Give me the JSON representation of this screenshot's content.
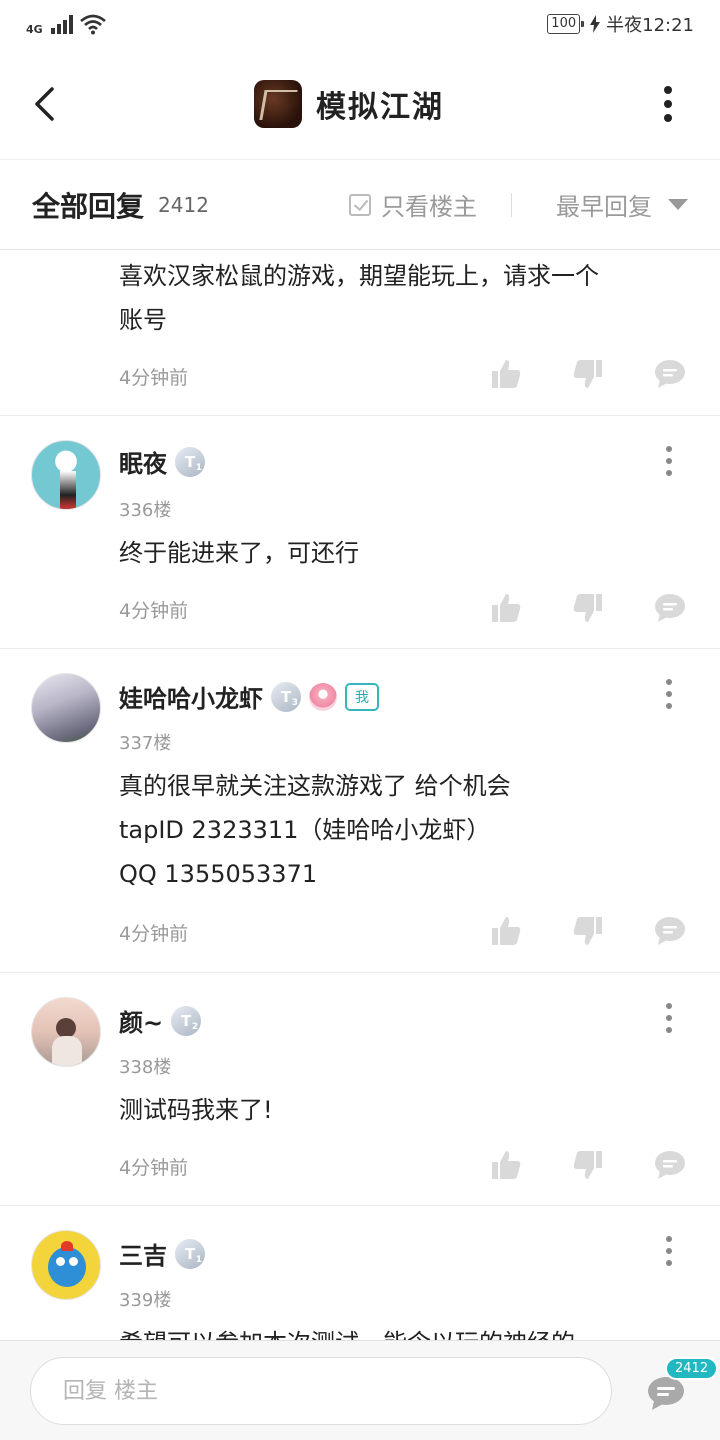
{
  "status_bar": {
    "network": "4G",
    "battery": "100",
    "time": "半夜12:21"
  },
  "header": {
    "title": "模拟江湖"
  },
  "filter_bar": {
    "title": "全部回复",
    "count": "2412",
    "only_op_label": "只看楼主",
    "sort_label": "最早回复"
  },
  "comments": [
    {
      "text_lines": [
        "喜欢汉家松鼠的游戏，期望能玩上，请求一个",
        "账号"
      ],
      "time": "4分钟前"
    },
    {
      "username": "眠夜",
      "badge": "T",
      "badge_level": "1",
      "floor": "336楼",
      "text_lines": [
        "终于能进来了，可还行"
      ],
      "time": "4分钟前"
    },
    {
      "username": "娃哈哈小龙虾",
      "badge": "T",
      "badge_level": "3",
      "me_label": "我",
      "floor": "337楼",
      "text_lines": [
        "真的很早就关注这款游戏了 给个机会",
        "tapID   2323311（娃哈哈小龙虾）",
        "QQ    1355053371"
      ],
      "time": "4分钟前"
    },
    {
      "username": "颜~",
      "badge": "T",
      "badge_level": "2",
      "floor": "338楼",
      "text_lines": [
        "测试码我来了!"
      ],
      "time": "4分钟前"
    },
    {
      "username": "三吉",
      "badge": "T",
      "badge_level": "1",
      "floor": "339楼",
      "text_lines": [
        "希望可以参加本次测试，能令以玩的神经的"
      ],
      "time": ""
    }
  ],
  "bottom_bar": {
    "reply_placeholder": "回复 楼主",
    "reply_count": "2412"
  },
  "colors": {
    "accent": "#21b8c2",
    "icon_gray": "#d9d9d9"
  }
}
